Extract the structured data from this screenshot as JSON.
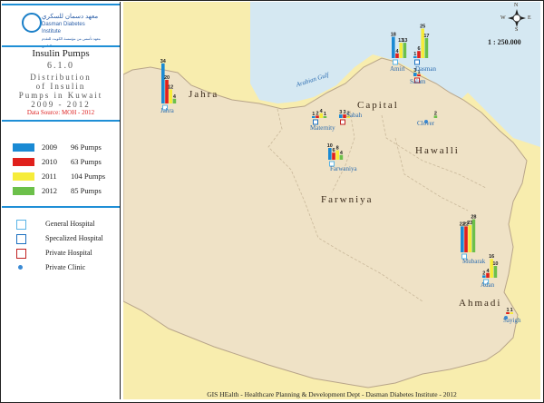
{
  "panel": {
    "logo_line1": "معهد دسمان للسكري",
    "logo_line2": "Dasman Diabetes Institute",
    "logo_line3": "معهد تأسس من مؤسسة الكويت للتقدم العلمي",
    "title": "Insulin Pumps",
    "code": "6.1.0",
    "subtitle_lines": [
      "Distribution",
      "of Insulin",
      "Pumps in Kuwait",
      "2009 - 2012"
    ],
    "source": "Data Source: MOH - 2012"
  },
  "legend": [
    {
      "year": "2009",
      "pumps": "96 Pumps",
      "color": "#1a8ad4"
    },
    {
      "year": "2010",
      "pumps": "63 Pumps",
      "color": "#e0201c"
    },
    {
      "year": "2011",
      "pumps": "104 Pumps",
      "color": "#f6ec3a"
    },
    {
      "year": "2012",
      "pumps": "85 Pumps",
      "color": "#6cc04a"
    }
  ],
  "facility_types": [
    {
      "label": "General Hospital",
      "icon": "general-hospital-icon",
      "color": "#5ab4e6"
    },
    {
      "label": "Specalized Hospital",
      "icon": "specialized-hospital-icon",
      "color": "#1a6fc0"
    },
    {
      "label": "Private Hospital",
      "icon": "private-hospital-icon",
      "color": "#c02020"
    },
    {
      "label": "Private Clinic",
      "icon": "private-clinic-icon",
      "color": "#3a8ad4"
    }
  ],
  "map": {
    "regions": [
      "Jahra",
      "Capital",
      "Hawalli",
      "Farwniya",
      "Ahmadi"
    ],
    "sea_label": "Arabian Gulf",
    "scale": "1 : 250.000",
    "compass": {
      "n": "N",
      "s": "S",
      "e": "E",
      "w": "W"
    },
    "facilities": [
      {
        "name": "Jahra",
        "values": [
          34,
          20,
          12,
          4
        ]
      },
      {
        "name": "Amiri",
        "values": [
          18,
          4,
          13,
          13
        ]
      },
      {
        "name": "Dasman",
        "values": [
          1,
          6,
          25,
          17
        ]
      },
      {
        "name": "Salam",
        "values": [
          3,
          1,
          null,
          null
        ]
      },
      {
        "name": "Maternity",
        "values": [
          1,
          2,
          4,
          1
        ]
      },
      {
        "name": "Sabah",
        "values": [
          3,
          3,
          2,
          null
        ]
      },
      {
        "name": "Clover",
        "values": [
          null,
          null,
          null,
          2
        ]
      },
      {
        "name": "Farwaniya",
        "values": [
          10,
          6,
          8,
          4
        ]
      },
      {
        "name": "Mubarak",
        "values": [
          22,
          22,
          23,
          28
        ]
      },
      {
        "name": "Adan",
        "values": [
          2,
          4,
          16,
          10
        ]
      },
      {
        "name": "Sayigh",
        "values": [
          null,
          1,
          1,
          null
        ]
      }
    ]
  },
  "footer": "GIS HEalth - Healthcare Planning & Development Dept - Dasman Diabetes Institute - 2012"
}
